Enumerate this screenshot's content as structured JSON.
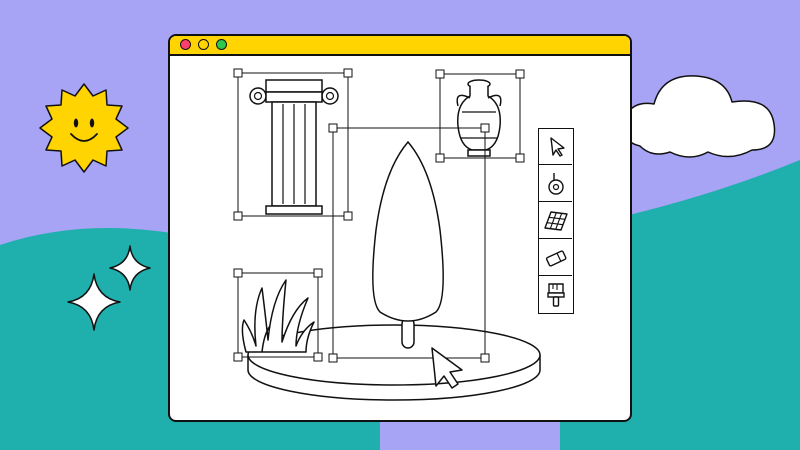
{
  "colors": {
    "sky": "#A7A3F5",
    "hill": "#1FAFAC",
    "titlebar": "#FFD400",
    "close_dot": "#FF3E6C",
    "minimize_dot": "#FFD400",
    "maximize_dot": "#2BC94A",
    "sun": "#FFD400",
    "outline": "#111111",
    "window": "#FFFFFF"
  },
  "window": {
    "controls": [
      "close",
      "minimize",
      "maximize"
    ]
  },
  "canvas": {
    "objects": [
      "column",
      "vase",
      "tree",
      "grass",
      "platform"
    ],
    "selected": [
      "column",
      "vase",
      "tree",
      "grass"
    ]
  },
  "toolbar": {
    "tools": [
      {
        "id": "select",
        "icon": "arrow-cursor-icon"
      },
      {
        "id": "pin",
        "icon": "pin-icon"
      },
      {
        "id": "grid",
        "icon": "grid-tile-icon"
      },
      {
        "id": "eraser",
        "icon": "eraser-icon"
      },
      {
        "id": "brush",
        "icon": "paintbrush-icon"
      }
    ]
  },
  "decor": [
    "sun-icon",
    "cloud-icon",
    "sparkle-icon"
  ]
}
